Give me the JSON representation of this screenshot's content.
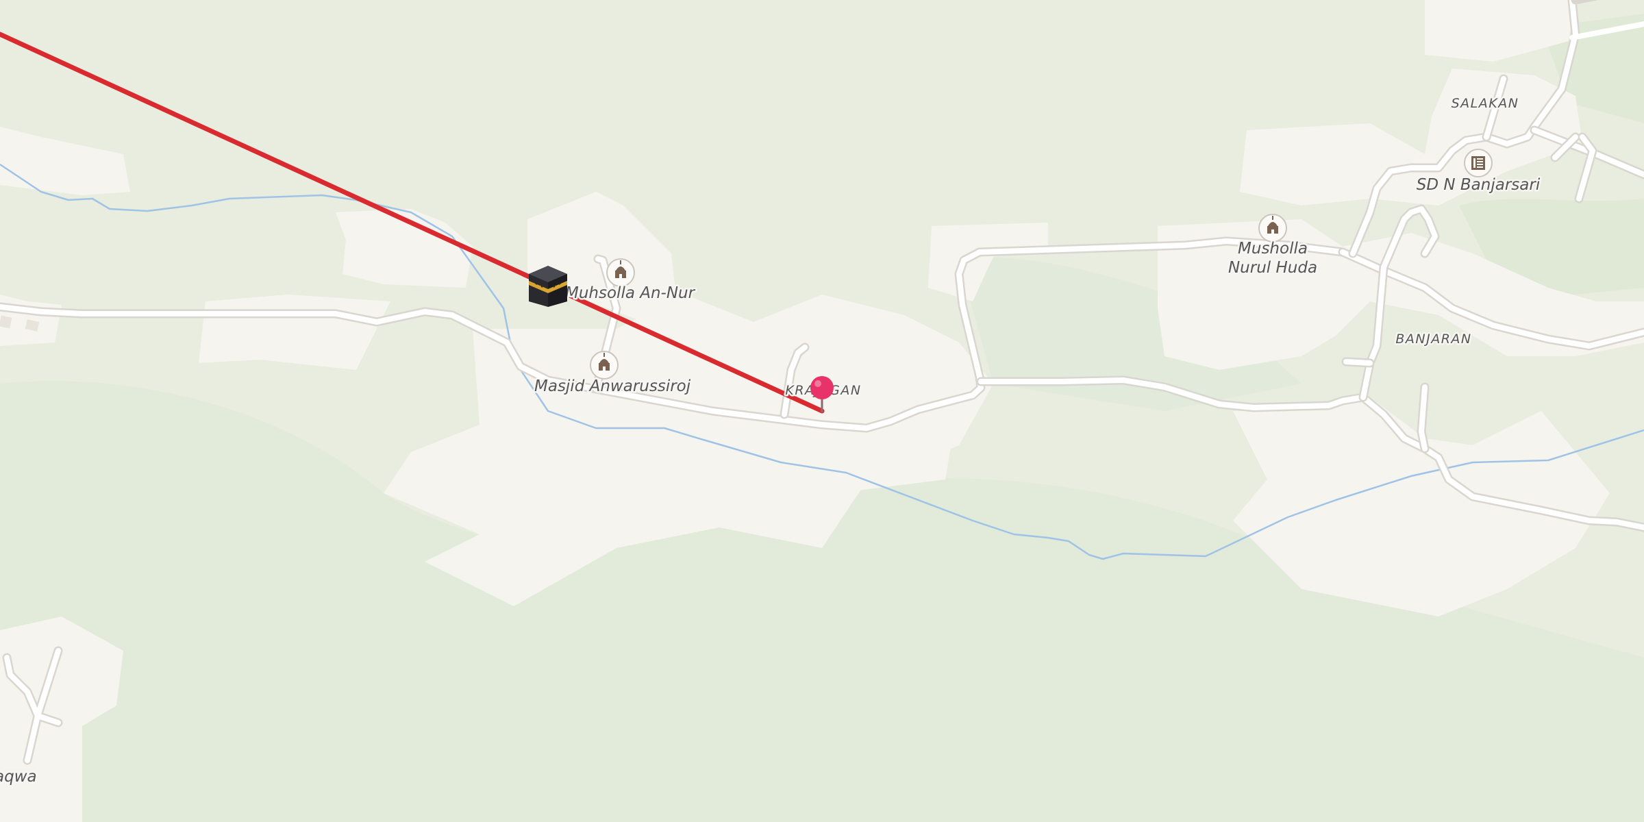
{
  "map": {
    "colors": {
      "land": "#e9eddf",
      "forest": "#dfe8d3",
      "settlement": "#f6f4ef",
      "road": "#ffffff",
      "road_casing": "#d8d6cf",
      "river": "#9fc3e6",
      "qibla_line": "#d92b2f",
      "pin": "#e8336a"
    },
    "places": [
      {
        "name": "SALAKAN"
      },
      {
        "name": "BANJARAN"
      },
      {
        "name": "KRAJAGAN"
      }
    ],
    "pois": [
      {
        "name": "Muhsolla An-Nur",
        "icon": "mosque-icon"
      },
      {
        "name": "Masjid Anwarussiroj",
        "icon": "mosque-icon"
      },
      {
        "name": "Musholla",
        "name_line2": "Nurul Huda",
        "icon": "mosque-icon"
      },
      {
        "name": "SD N Banjarsari",
        "icon": "school-icon"
      },
      {
        "name": "aqwa",
        "icon": ""
      }
    ],
    "markers": {
      "kaaba": {
        "icon": "kaaba-icon"
      },
      "location_pin": {
        "icon": "map-pin-icon"
      }
    },
    "qibla_line": {
      "label": "qibla direction line"
    }
  }
}
